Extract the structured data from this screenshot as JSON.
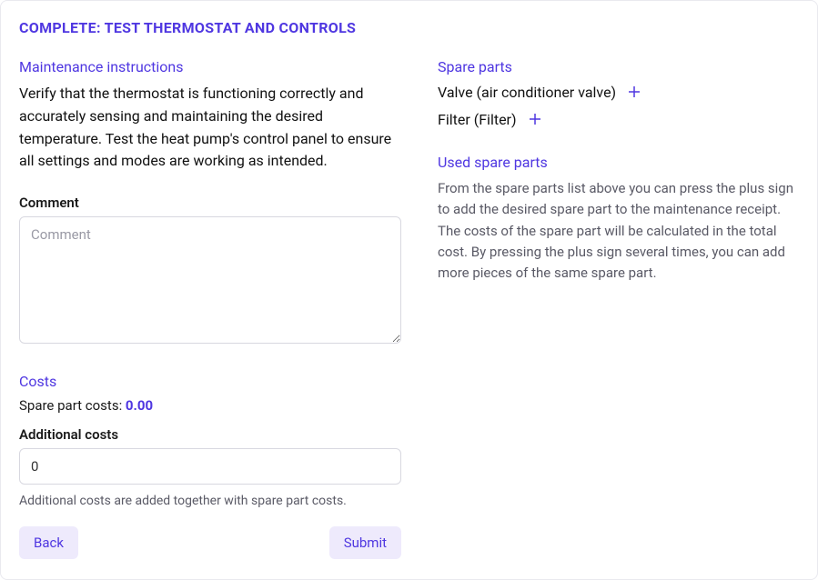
{
  "header": {
    "title": "COMPLETE: TEST THERMOSTAT AND CONTROLS"
  },
  "left": {
    "instructions_title": "Maintenance instructions",
    "instructions_body": "Verify that the thermostat is functioning correctly and accurately sensing and maintaining the desired temperature. Test the heat pump's control panel to ensure all settings and modes are working as intended.",
    "comment_label": "Comment",
    "comment_placeholder": "Comment",
    "comment_value": "",
    "costs_title": "Costs",
    "spare_costs_label": "Spare part costs: ",
    "spare_costs_value": "0.00",
    "additional_costs_label": "Additional costs",
    "additional_costs_value": "0",
    "additional_costs_help": "Additional costs are added together with spare part costs.",
    "back_label": "Back",
    "submit_label": "Submit"
  },
  "right": {
    "spare_parts_title": "Spare parts",
    "spare_parts": [
      {
        "label": "Valve (air conditioner valve)"
      },
      {
        "label": "Filter (Filter)"
      }
    ],
    "used_title": "Used spare parts",
    "used_desc": "From the spare parts list above you can press the plus sign to add the desired spare part to the maintenance receipt. The costs of the spare part will be calculated in the total cost. By pressing the plus sign several times, you can add more pieces of the same spare part."
  }
}
